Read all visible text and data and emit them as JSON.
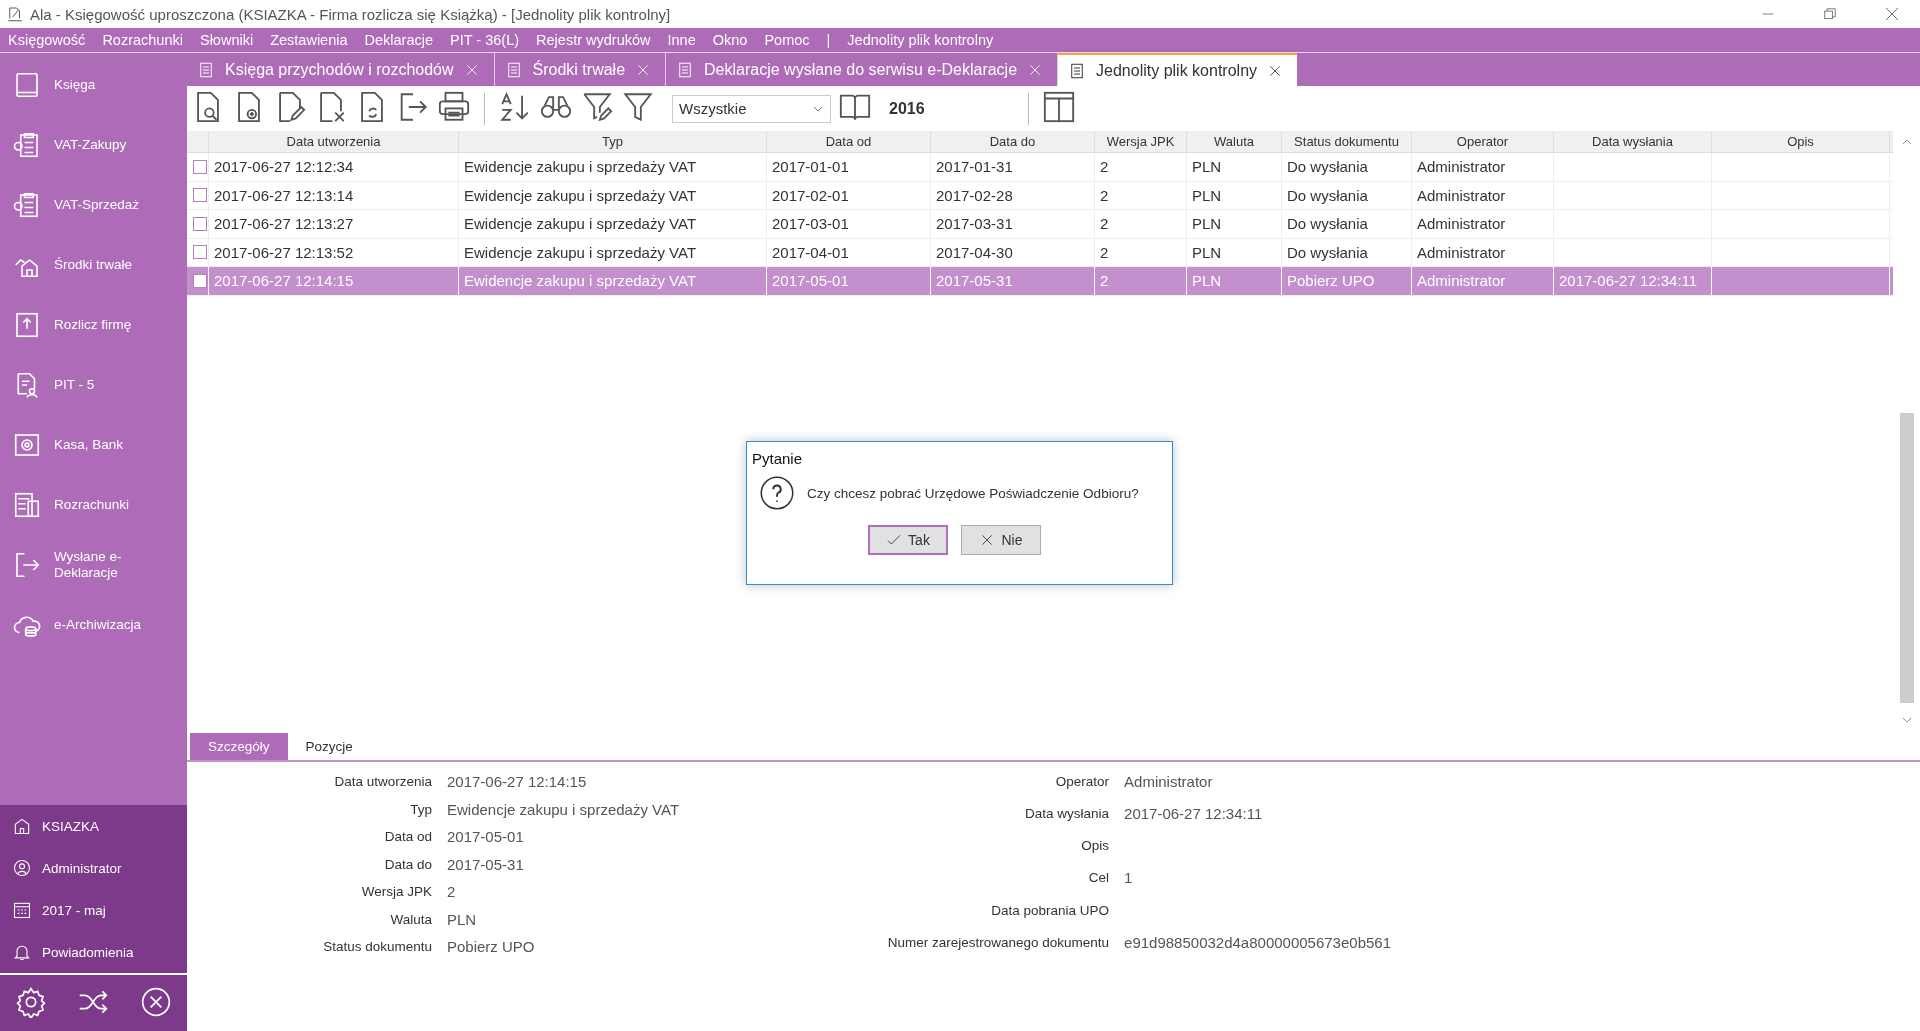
{
  "window": {
    "title": "Ala - Księgowość uproszczona (KSIAZKA - Firma rozlicza się Książką) - [Jednolity plik kontrolny]"
  },
  "menu": [
    {
      "label": "Księgowość"
    },
    {
      "label": "Rozrachunki"
    },
    {
      "label": "Słowniki"
    },
    {
      "label": "Zestawienia"
    },
    {
      "label": "Deklaracje"
    },
    {
      "label": "PIT - 36(L)"
    },
    {
      "label": "Rejestr wydruków"
    },
    {
      "label": "Inne"
    },
    {
      "label": "Okno"
    },
    {
      "label": "Pomoc"
    },
    {
      "label": "|"
    },
    {
      "label": "Jednolity plik kontrolny"
    }
  ],
  "doc_tabs": [
    {
      "label": "Księga przychodów i rozchodów",
      "selected": false
    },
    {
      "label": "Środki trwałe",
      "selected": false
    },
    {
      "label": "Deklaracje wysłane do serwisu e-Deklaracje",
      "selected": false
    },
    {
      "label": "Jednolity plik kontrolny",
      "selected": true
    }
  ],
  "sidebar": {
    "items": [
      {
        "label": "Księga"
      },
      {
        "label": "VAT-Zakupy"
      },
      {
        "label": "VAT-Sprzedaż"
      },
      {
        "label": "Środki trwałe"
      },
      {
        "label": "Rozlicz firmę"
      },
      {
        "label": "PIT - 5"
      },
      {
        "label": "Kasa, Bank"
      },
      {
        "label": "Rozrachunki"
      },
      {
        "label": "Wysłane e-Deklaracje"
      },
      {
        "label": "e-Archiwizacja"
      }
    ],
    "footer": [
      {
        "label": "KSIAZKA"
      },
      {
        "label": "Administrator"
      },
      {
        "label": "2017  - maj"
      },
      {
        "label": "Powiadomienia"
      }
    ]
  },
  "toolbar": {
    "filter": "Wszystkie",
    "year": "2016"
  },
  "table": {
    "columns": [
      "Data utworzenia",
      "Typ",
      "Data od",
      "Data do",
      "Wersja JPK",
      "Waluta",
      "Status dokumentu",
      "Operator",
      "Data wysłania",
      "Opis"
    ],
    "rows": [
      {
        "checked": false,
        "selected": false,
        "cells": [
          "2017-06-27 12:12:34",
          "Ewidencje zakupu i sprzedaży VAT",
          "2017-01-01",
          "2017-01-31",
          "2",
          "PLN",
          "Do wysłania",
          "Administrator",
          "",
          ""
        ]
      },
      {
        "checked": false,
        "selected": false,
        "cells": [
          "2017-06-27 12:13:14",
          "Ewidencje zakupu i sprzedaży VAT",
          "2017-02-01",
          "2017-02-28",
          "2",
          "PLN",
          "Do wysłania",
          "Administrator",
          "",
          ""
        ]
      },
      {
        "checked": false,
        "selected": false,
        "cells": [
          "2017-06-27 12:13:27",
          "Ewidencje zakupu i sprzedaży VAT",
          "2017-03-01",
          "2017-03-31",
          "2",
          "PLN",
          "Do wysłania",
          "Administrator",
          "",
          ""
        ]
      },
      {
        "checked": false,
        "selected": false,
        "cells": [
          "2017-06-27 12:13:52",
          "Ewidencje zakupu i sprzedaży VAT",
          "2017-04-01",
          "2017-04-30",
          "2",
          "PLN",
          "Do wysłania",
          "Administrator",
          "",
          ""
        ]
      },
      {
        "checked": false,
        "selected": true,
        "cells": [
          "2017-06-27 12:14:15",
          "Ewidencje zakupu i sprzedaży VAT",
          "2017-05-01",
          "2017-05-31",
          "2",
          "PLN",
          "Pobierz UPO",
          "Administrator",
          "2017-06-27 12:34:11",
          ""
        ]
      }
    ]
  },
  "detail_tabs": [
    {
      "label": "Szczegóły",
      "selected": true
    },
    {
      "label": "Pozycje",
      "selected": false
    }
  ],
  "details": {
    "left": [
      {
        "label": "Data utworzenia",
        "value": "2017-06-27 12:14:15"
      },
      {
        "label": "Typ",
        "value": "Ewidencje zakupu i sprzedaży VAT"
      },
      {
        "label": "Data od",
        "value": "2017-05-01"
      },
      {
        "label": "Data do",
        "value": "2017-05-31"
      },
      {
        "label": "Wersja JPK",
        "value": "2"
      },
      {
        "label": "Waluta",
        "value": "PLN"
      },
      {
        "label": "Status dokumentu",
        "value": "Pobierz UPO"
      }
    ],
    "right": [
      {
        "label": "Operator",
        "value": "Administrator"
      },
      {
        "label": "Data wysłania",
        "value": "2017-06-27 12:34:11"
      },
      {
        "label": "Opis"
      },
      {
        "label": "Cel",
        "value": "1"
      },
      {
        "label": "Data pobrania UPO"
      },
      {
        "label": "Numer zarejestrowanego dokumentu",
        "value": "e91d98850032d4a80000005673e0b561"
      }
    ]
  },
  "dialog": {
    "title": "Pytanie",
    "message": "Czy chcesz pobrać Urzędowe Poświadczenie Odbioru?",
    "buttons": [
      {
        "label": "Tak",
        "kind": "yes",
        "focused": true
      },
      {
        "label": "Nie",
        "kind": "no",
        "focused": false
      }
    ]
  }
}
